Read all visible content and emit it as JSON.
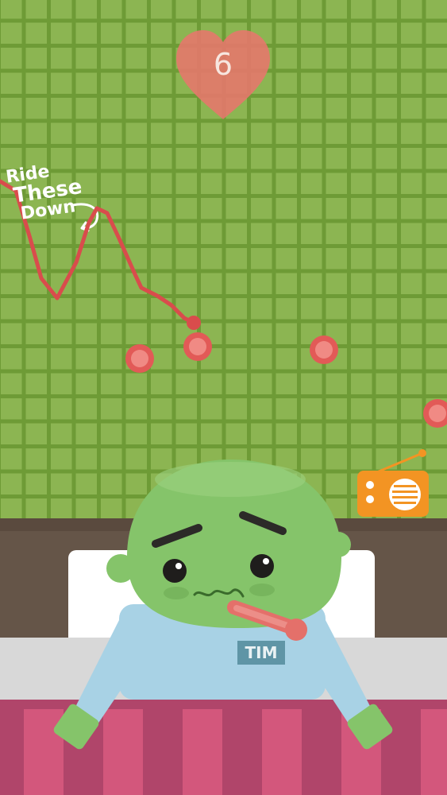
{
  "hud": {
    "score": "6",
    "score_icon": "heart-icon",
    "heart_color": "#e4786c"
  },
  "hint": {
    "lines": [
      "Ride",
      "These",
      "Down"
    ],
    "arrow_icon": "curved-arrow-icon"
  },
  "character": {
    "name_tag": "TIM",
    "skin_color": "#85c46a",
    "shirt_color": "#a8d2e5"
  },
  "props": {
    "radio_icon": "radio-icon",
    "radio_color": "#f39423",
    "thermometer_icon": "thermometer-icon"
  },
  "colors": {
    "wall": "#8cb552",
    "wall_grid": "#6e9b36",
    "line": "#d94c4c",
    "dot": "#e25a57",
    "headboard": "#655548",
    "pillow": "#ffffff",
    "mattress": "#d8d8d8",
    "blanket_light": "#d3577c",
    "blanket_dark": "#b0456a"
  }
}
